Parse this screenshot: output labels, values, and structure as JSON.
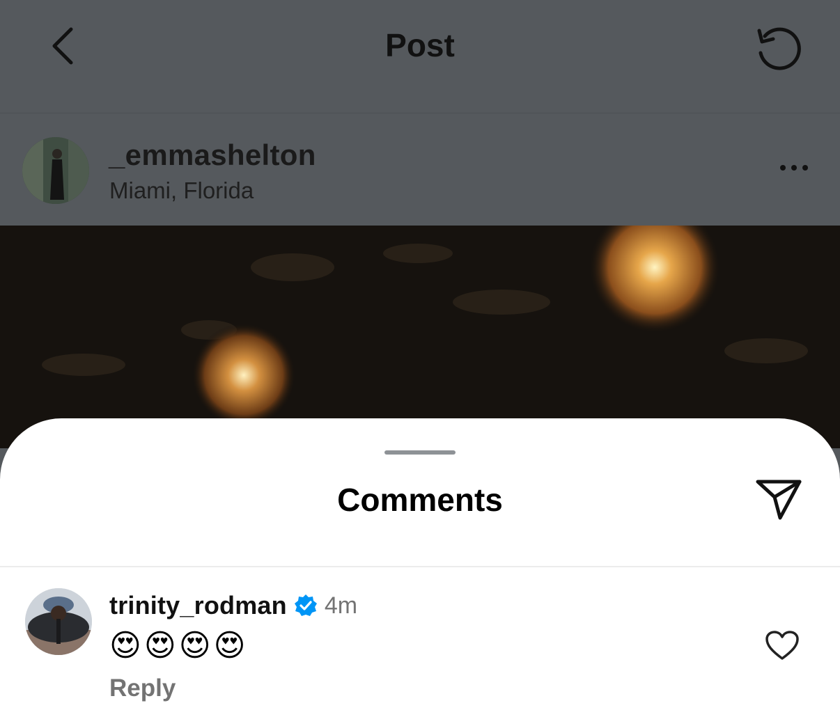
{
  "header": {
    "title": "Post",
    "back_icon": "chevron-left-icon",
    "refresh_icon": "refresh-icon"
  },
  "post": {
    "username": "_emmashelton",
    "location": "Miami, Florida",
    "more_icon": "more-horizontal-icon"
  },
  "comments_sheet": {
    "title": "Comments",
    "share_icon": "paper-plane-icon",
    "comments": [
      {
        "username": "trinity_rodman",
        "verified": true,
        "time": "4m",
        "text": "😍😍😍😍",
        "reply_label": "Reply"
      }
    ]
  },
  "colors": {
    "dim_overlay": "#55595d",
    "verified_badge": "#0095f6",
    "secondary_text": "#737373"
  }
}
